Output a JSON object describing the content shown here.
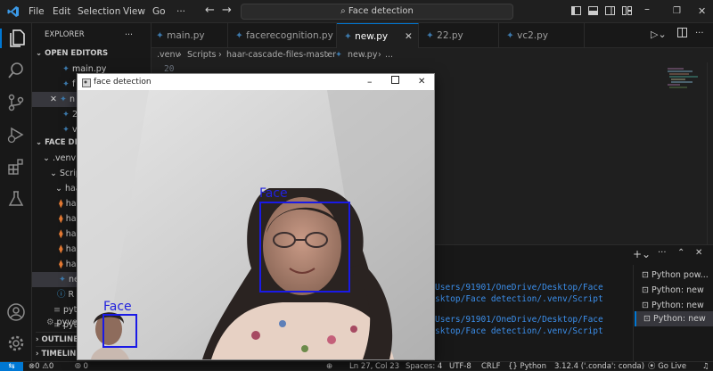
{
  "titlebar": {
    "menu": [
      "File",
      "Edit",
      "Selection",
      "View",
      "Go",
      "···"
    ],
    "search_text": "Face detection"
  },
  "activity_icons": [
    "explorer-icon",
    "search-icon",
    "source-control-icon",
    "run-debug-icon",
    "extensions-icon",
    "testing-icon",
    "account-icon",
    "settings-gear-icon"
  ],
  "sidebar": {
    "header": "EXPLORER",
    "open_editors_label": "OPEN EDITORS",
    "open_editors": [
      "main.py",
      "f",
      "n",
      "2",
      "v"
    ],
    "folder_label": "FACE DETE",
    "tree": [
      ".venv",
      "Scrip",
      "haa",
      "ha",
      "ha",
      "ha",
      "ha",
      "ha",
      "ne",
      "R",
      "pyt",
      "pyt",
      "pyve"
    ],
    "outline_label": "OUTLINE",
    "timeline_label": "TIMELIN"
  },
  "tabs": [
    {
      "label": "main.py"
    },
    {
      "label": "facerecognition.py"
    },
    {
      "label": "new.py",
      "active": true
    },
    {
      "label": "22.py"
    },
    {
      "label": "vc2.py"
    }
  ],
  "breadcrumb": [
    ".venv",
    "Scripts",
    "haar-cascade-files-master",
    "new.py",
    "..."
  ],
  "editor": {
    "line_number": "20"
  },
  "terminal": {
    "lines": [
      "Users/91901/OneDrive/Desktop/Face",
      "sktop/Face detection/.venv/Script",
      "Users/91901/OneDrive/Desktop/Face",
      "sktop/Face detection/.venv/Script"
    ],
    "sessions": [
      "Python pow...",
      "Python: new",
      "Python: new",
      "Python: new"
    ]
  },
  "statusbar": {
    "errors": "0",
    "warnings": "0",
    "ports": "0",
    "position": "Ln 27, Col 23",
    "spaces": "Spaces: 4",
    "encoding": "UTF-8",
    "eol": "CRLF",
    "language": "Python",
    "interpreter": "3.12.4 ('.conda': conda)",
    "golive": "Go Live"
  },
  "cv_window": {
    "title": "face detection",
    "face_label_1": "Face",
    "face_label_2": "Face"
  },
  "colors": {
    "accent": "#0078d4",
    "face_box": "#1a1ae6"
  }
}
